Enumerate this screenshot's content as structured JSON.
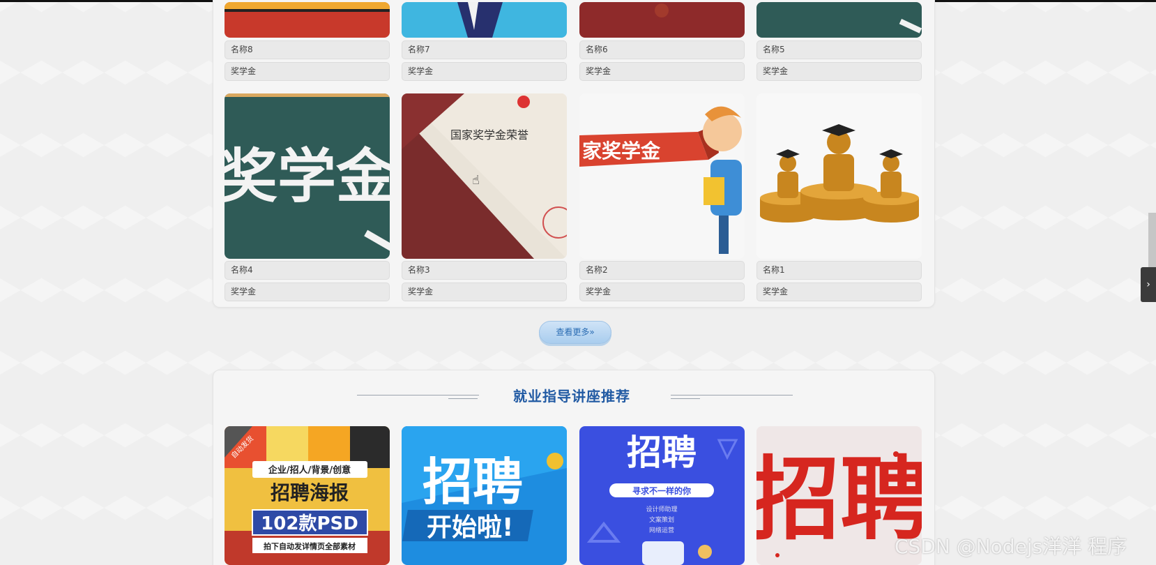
{
  "scholarship_section": {
    "row1": [
      {
        "name": "名称8",
        "category": "奖学金"
      },
      {
        "name": "名称7",
        "category": "奖学金"
      },
      {
        "name": "名称6",
        "category": "奖学金"
      },
      {
        "name": "名称5",
        "category": "奖学金"
      }
    ],
    "row2": [
      {
        "name": "名称4",
        "category": "奖学金",
        "image_text": "奖学金"
      },
      {
        "name": "名称3",
        "category": "奖学金",
        "image_text": "国家奖学金荣誉"
      },
      {
        "name": "名称2",
        "category": "奖学金",
        "image_text": "家奖学金"
      },
      {
        "name": "名称1",
        "category": "奖学金"
      }
    ],
    "more_button": "查看更多»"
  },
  "lecture_section": {
    "title": "就业指导讲座推荐",
    "posters": [
      {
        "line1": "企业/招人/背景/创意",
        "line2": "招聘海报",
        "line3": "102款PSD",
        "line4": "拍下自动发详情页全部素材",
        "corner": "自动发货"
      },
      {
        "line1": "招聘",
        "line2": "开始啦!"
      },
      {
        "line1": "招聘",
        "line2": "寻求不一样的你",
        "line3": "设计师助理",
        "line4": "文案策划",
        "line5": "网络运营"
      },
      {
        "line1": "招聘"
      }
    ]
  },
  "watermark": "CSDN @Nodejs洋洋 程序",
  "side_tab_icon": "chevron-right-icon",
  "colors": {
    "title": "#215aa3",
    "button": "#a9cdee"
  }
}
